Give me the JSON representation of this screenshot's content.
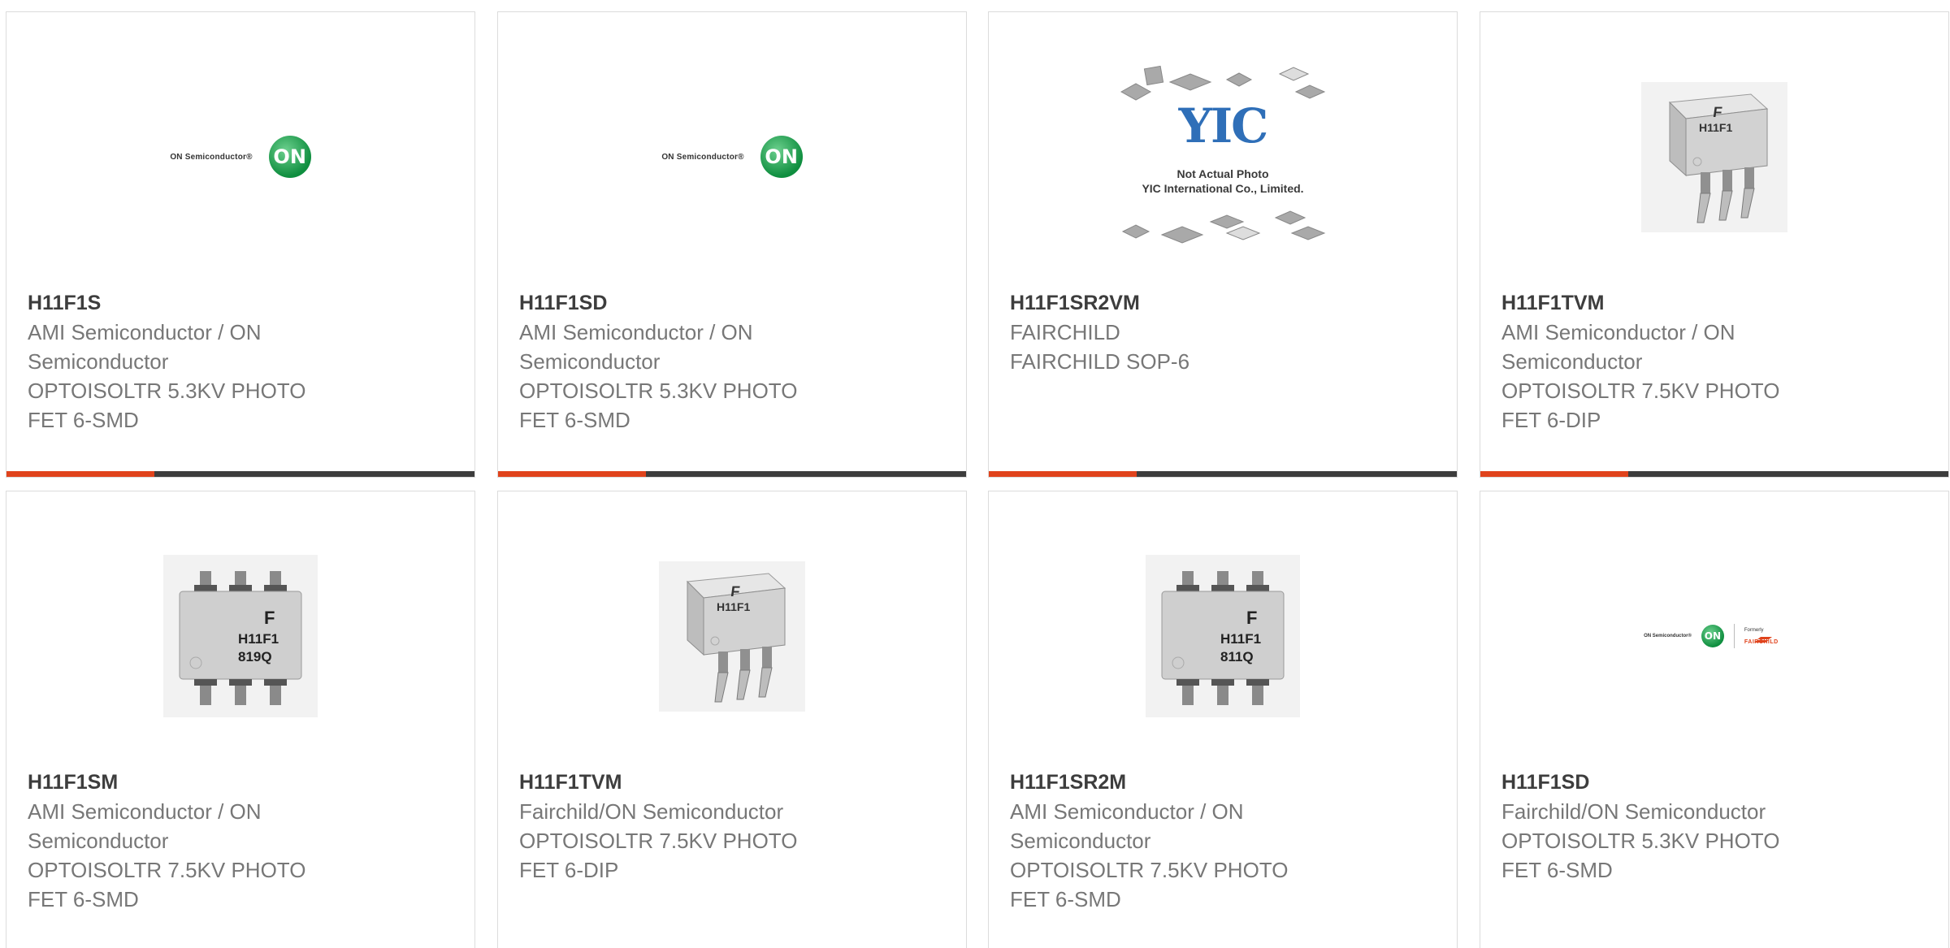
{
  "products": [
    {
      "pn": "H11F1S",
      "lines": [
        "AMI Semiconductor / ON",
        "Semiconductor",
        "OPTOISOLTR 5.3KV PHOTO",
        "FET 6-SMD"
      ],
      "image": "on-semi-logo"
    },
    {
      "pn": "H11F1SD",
      "lines": [
        "AMI Semiconductor / ON",
        "Semiconductor",
        "OPTOISOLTR 5.3KV PHOTO",
        "FET 6-SMD"
      ],
      "image": "on-semi-logo"
    },
    {
      "pn": "H11F1SR2VM",
      "lines": [
        "FAIRCHILD",
        "FAIRCHILD SOP-6"
      ],
      "image": "yic-placeholder"
    },
    {
      "pn": "H11F1TVM",
      "lines": [
        "AMI Semiconductor / ON",
        "Semiconductor",
        "OPTOISOLTR 7.5KV PHOTO",
        "FET 6-DIP"
      ],
      "image": "chip-dip-photo"
    },
    {
      "pn": "H11F1SM",
      "lines": [
        "AMI Semiconductor / ON",
        "Semiconductor",
        "OPTOISOLTR 7.5KV PHOTO",
        "FET 6-SMD"
      ],
      "image": "chip-smd-photo"
    },
    {
      "pn": "H11F1TVM",
      "lines": [
        "Fairchild/ON Semiconductor",
        "OPTOISOLTR 7.5KV PHOTO",
        "FET 6-DIP"
      ],
      "image": "chip-dip-photo"
    },
    {
      "pn": "H11F1SR2M",
      "lines": [
        "AMI Semiconductor / ON",
        "Semiconductor",
        "OPTOISOLTR 7.5KV PHOTO",
        "FET 6-SMD"
      ],
      "image": "chip-smd-photo"
    },
    {
      "pn": "H11F1SD",
      "lines": [
        "Fairchild/ON Semiconductor",
        "OPTOISOLTR 5.3KV PHOTO",
        "FET 6-SMD"
      ],
      "image": "on-fairchild-logo"
    }
  ],
  "logos": {
    "on_text": "ON Semiconductor®",
    "on_mark": "ON",
    "formerly": "Formerly",
    "fairchild": "FAIRCHILD"
  },
  "yic": {
    "mark": "YIC",
    "line1": "Not Actual Photo",
    "line2": "YIC International Co., Limited."
  },
  "chip": {
    "brand_glyph": "F",
    "part_mark": "H11F1",
    "smd_code_1": "819Q",
    "smd_code_2": "811Q"
  },
  "colors": {
    "accent": "#e0431c",
    "bar": "#3d3d3d",
    "border": "#dcdcdc",
    "text": "#777777",
    "title": "#3d3d3d",
    "on_green": "#0f8e3f"
  }
}
